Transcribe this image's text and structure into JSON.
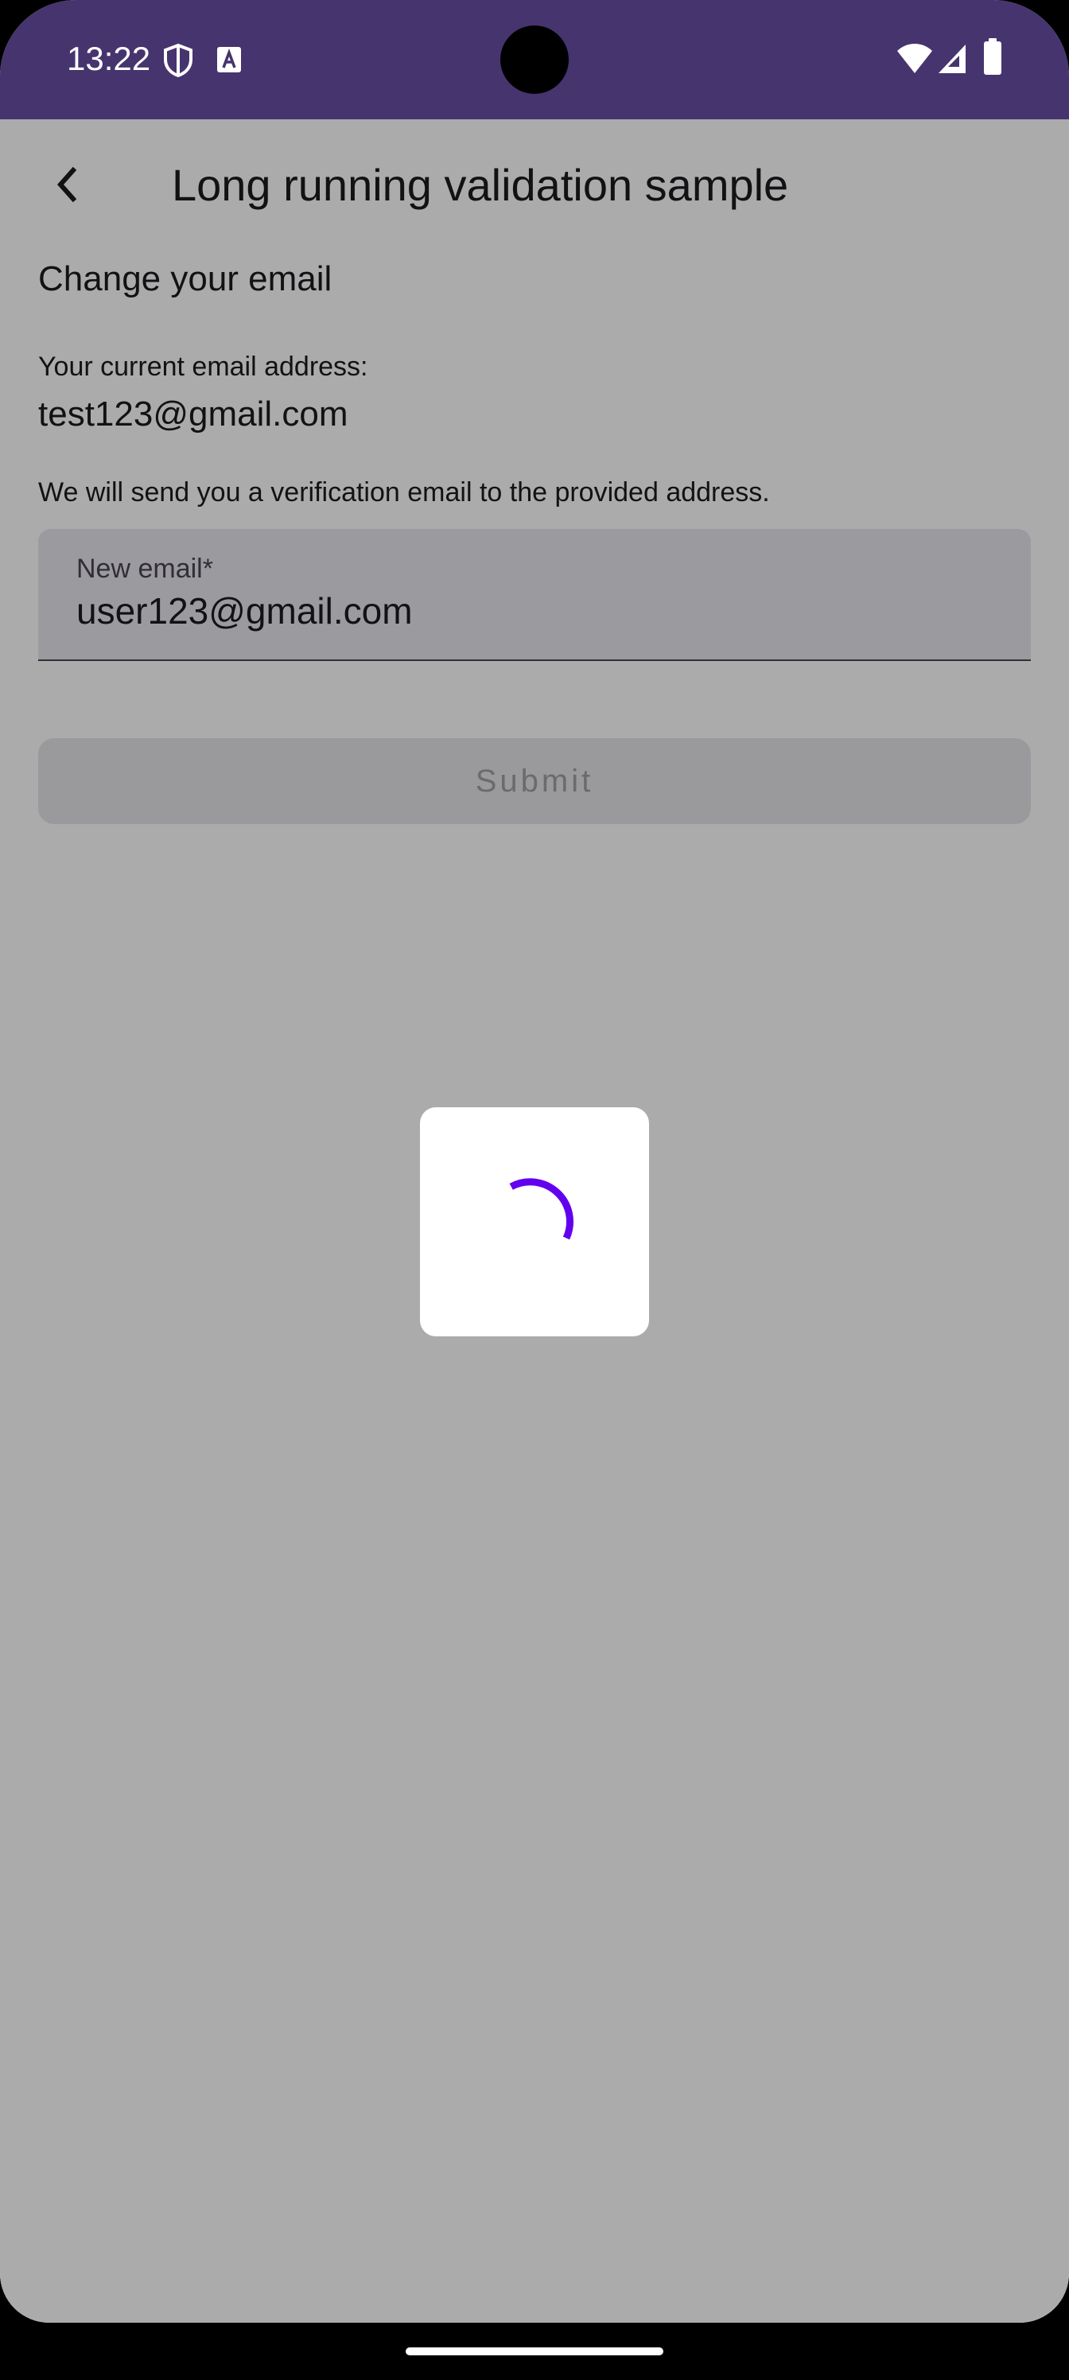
{
  "status_bar": {
    "time": "13:22",
    "icons": [
      "shield-icon",
      "text-a-icon",
      "wifi-icon",
      "cell-signal-icon",
      "battery-icon"
    ]
  },
  "app_bar": {
    "back_icon": "arrow-back-icon",
    "title": "Long running validation sample"
  },
  "form": {
    "section_title": "Change your email",
    "current_email_label": "Your current email address:",
    "current_email_value": "test123@gmail.com",
    "verification_note": "We will send you a verification email to the provided address.",
    "new_email_label": "New email*",
    "new_email_value": "user123@gmail.com",
    "submit_label": "Submit"
  },
  "loading": {
    "visible": true,
    "spinner_icon": "progress-spinner-icon"
  },
  "colors": {
    "status_bar": "#46346e",
    "spinner": "#6200ee",
    "scrim": "rgba(0,0,0,0.33)"
  }
}
